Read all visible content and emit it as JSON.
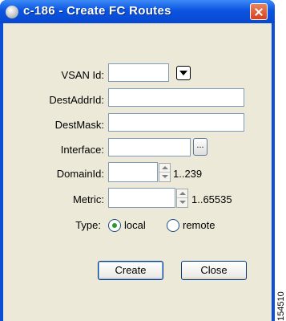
{
  "window": {
    "title": "c-186 - Create FC Routes"
  },
  "form": {
    "vsan_label": "VSAN Id:",
    "vsan_value": "",
    "dest_addr_label": "DestAddrId:",
    "dest_addr_value": "",
    "dest_mask_label": "DestMask:",
    "dest_mask_value": "",
    "interface_label": "Interface:",
    "interface_value": "",
    "browse_label": "...",
    "domain_label": "DomainId:",
    "domain_value": "",
    "domain_range": "1..239",
    "metric_label": "Metric:",
    "metric_value": "",
    "metric_range": "1..65535",
    "type_label": "Type:",
    "type_options": [
      "local",
      "remote"
    ],
    "type_selected": "local"
  },
  "buttons": {
    "create": "Create",
    "close": "Close"
  },
  "figure_number": "154510",
  "colors": {
    "titlebar": "#0b54e0",
    "dialog_bg": "#ece9d8",
    "field_border": "#7f9db9",
    "close_button": "#d7401f",
    "radio_selected": "#2a9a2a"
  },
  "icons": [
    "app-icon",
    "close-icon",
    "dropdown-arrow-icon",
    "browse-icon",
    "spin-up-icon",
    "spin-down-icon"
  ]
}
